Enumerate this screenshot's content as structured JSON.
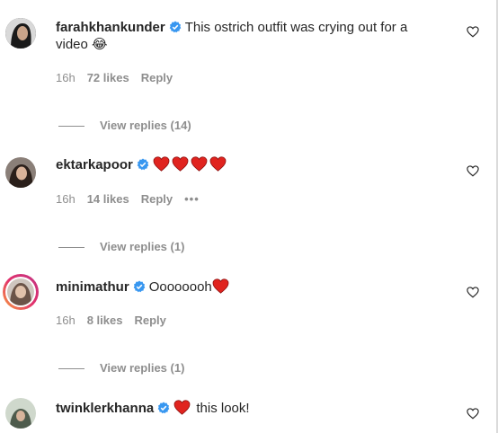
{
  "comments": [
    {
      "username": "farahkhankunder",
      "text_line1": "This ostrich outfit was crying out for a",
      "text_line2": "video 😂",
      "time": "16h",
      "likes": "72 likes",
      "reply": "Reply",
      "view_replies": "View replies (14)"
    },
    {
      "username": "ektarkapoor",
      "text": "❤️❤️❤️❤️",
      "heart_count": 4,
      "time": "16h",
      "likes": "14 likes",
      "reply": "Reply",
      "more": "•••",
      "view_replies": "View replies (1)"
    },
    {
      "username": "minimathur",
      "text": "Oooooooh",
      "time": "16h",
      "likes": "8 likes",
      "reply": "Reply",
      "view_replies": "View replies (1)"
    },
    {
      "username": "twinklerkhanna",
      "text": "this look!"
    }
  ],
  "colors": {
    "heart": "#e0241f",
    "verified": "#3897f0",
    "meta": "#8e8e8e"
  },
  "icons": {
    "like": "heart-outline-icon",
    "verified": "verified-badge-icon"
  }
}
